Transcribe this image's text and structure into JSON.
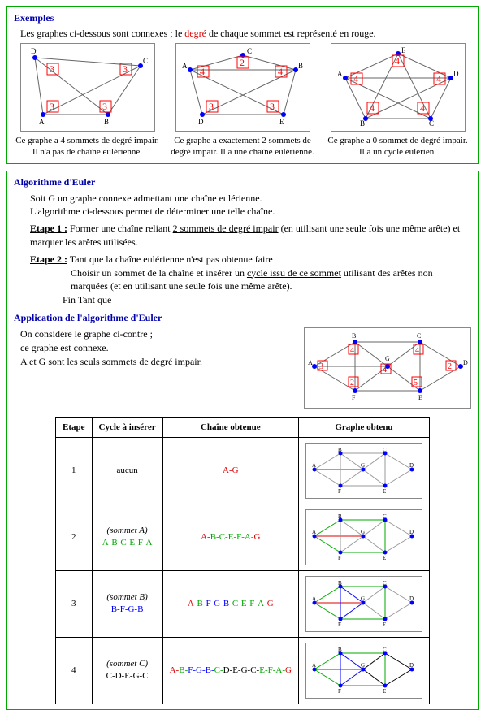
{
  "examples": {
    "title": "Exemples",
    "intro_before": "Les graphes ci-dessous sont connexes ; le ",
    "intro_word": "degré",
    "intro_after": " de chaque sommet est représenté en rouge.",
    "items": [
      {
        "caption": "Ce graphe a 4 sommets de degré impair. Il n'a pas de chaîne eulérienne.",
        "degrees": [
          "3",
          "3",
          "3",
          "3"
        ],
        "labels": [
          "A",
          "B",
          "C",
          "D"
        ]
      },
      {
        "caption": "Ce graphe a exactement 2 sommets de degré impair. Il a une chaîne eulérienne.",
        "degrees": [
          "4",
          "4",
          "2",
          "3",
          "3"
        ],
        "labels": [
          "A",
          "B",
          "C",
          "D",
          "E"
        ]
      },
      {
        "caption": "Ce graphe a 0 sommet de degré impair. Il a un cycle eulérien.",
        "degrees": [
          "4",
          "4",
          "4",
          "4",
          "4"
        ],
        "labels": [
          "A",
          "B",
          "C",
          "D",
          "E"
        ]
      }
    ]
  },
  "algo": {
    "title": "Algorithme d'Euler",
    "intro1": "Soit G un graphe connexe admettant une chaîne eulérienne.",
    "intro2": "L'algorithme ci-dessous permet de déterminer une telle chaîne.",
    "step1_label": "Etape 1 :",
    "step1_before": "Former une chaîne reliant ",
    "step1_underlined": "2 sommets de degré impair",
    "step1_after": " (en utilisant une seule fois une même arête) et marquer les arêtes utilisées.",
    "step2_label": "Etape 2 :",
    "step2_line1": "Tant que la chaîne eulérienne n'est pas obtenue faire",
    "step2_line2_before": "Choisir un sommet de la chaîne et insérer un ",
    "step2_line2_underlined": "cycle issu de ce sommet",
    "step2_line2_after": " utilisant des arêtes non marquées (et en utilisant une seule fois une même arête).",
    "step2_line3": "Fin Tant que"
  },
  "application": {
    "title": "Application de l'algorithme d'Euler",
    "text1": "On considère le graphe ci-contre ;",
    "text2": "ce graphe est connexe.",
    "text3": "A et G sont les seuls sommets de degré impair.",
    "graph": {
      "labels": [
        "A",
        "B",
        "C",
        "D",
        "E",
        "F",
        "G"
      ],
      "degrees": [
        "3",
        "4",
        "4",
        "2",
        "5",
        "2",
        "4"
      ]
    }
  },
  "table": {
    "headers": [
      "Etape",
      "Cycle à insérer",
      "Chaîne obtenue",
      "Graphe obtenu"
    ],
    "rows": [
      {
        "num": "1",
        "cycle_note": "aucun",
        "cycle_chain": "",
        "chain_coloring": [
          [
            "A-G",
            "red"
          ]
        ]
      },
      {
        "num": "2",
        "cycle_note": "(sommet A)",
        "cycle_chain": "A-B-C-E-F-A",
        "chain_coloring": [
          [
            "A-",
            "red"
          ],
          [
            "B-C-E-F-A-",
            "green"
          ],
          [
            "G",
            "red"
          ]
        ]
      },
      {
        "num": "3",
        "cycle_note": "(sommet B)",
        "cycle_chain": "B-F-G-B",
        "chain_coloring": [
          [
            "A-",
            "red"
          ],
          [
            "B-",
            "green"
          ],
          [
            "F-G-B-",
            "blue"
          ],
          [
            "C-E-F-A-",
            "green"
          ],
          [
            "G",
            "red"
          ]
        ]
      },
      {
        "num": "4",
        "cycle_note": "(sommet C)",
        "cycle_chain": "C-D-E-G-C",
        "chain_coloring": [
          [
            "A-",
            "red"
          ],
          [
            "B-",
            "green"
          ],
          [
            "F-G-B-",
            "blue"
          ],
          [
            "C-",
            "green"
          ],
          [
            "D-E-G-C-",
            "black"
          ],
          [
            "E-F-A-",
            "green"
          ],
          [
            "G",
            "red"
          ]
        ]
      }
    ]
  },
  "chart_data": {
    "type": "diagram",
    "description": "Graph theory illustrations of Euler paths/cycles",
    "example_graphs": [
      {
        "vertices": [
          "A",
          "B",
          "C",
          "D"
        ],
        "degree_counts": {
          "A": 3,
          "B": 3,
          "C": 3,
          "D": 3
        },
        "eulerian": "none"
      },
      {
        "vertices": [
          "A",
          "B",
          "C",
          "D",
          "E"
        ],
        "degree_counts": {
          "A": 4,
          "B": 4,
          "C": 2,
          "D": 3,
          "E": 3
        },
        "eulerian": "path"
      },
      {
        "vertices": [
          "A",
          "B",
          "C",
          "D",
          "E"
        ],
        "degree_counts": {
          "A": 4,
          "B": 4,
          "C": 4,
          "D": 4,
          "E": 4
        },
        "eulerian": "cycle"
      }
    ],
    "application_graph": {
      "vertices": [
        "A",
        "B",
        "C",
        "D",
        "E",
        "F",
        "G"
      ],
      "degrees": {
        "A": 3,
        "B": 4,
        "C": 4,
        "D": 2,
        "E": 5,
        "F": 2,
        "G": 4
      },
      "odd_degree": [
        "A",
        "G"
      ]
    },
    "euler_chain_result": "A-B-F-G-B-C-D-E-G-C-E-F-A-G"
  }
}
